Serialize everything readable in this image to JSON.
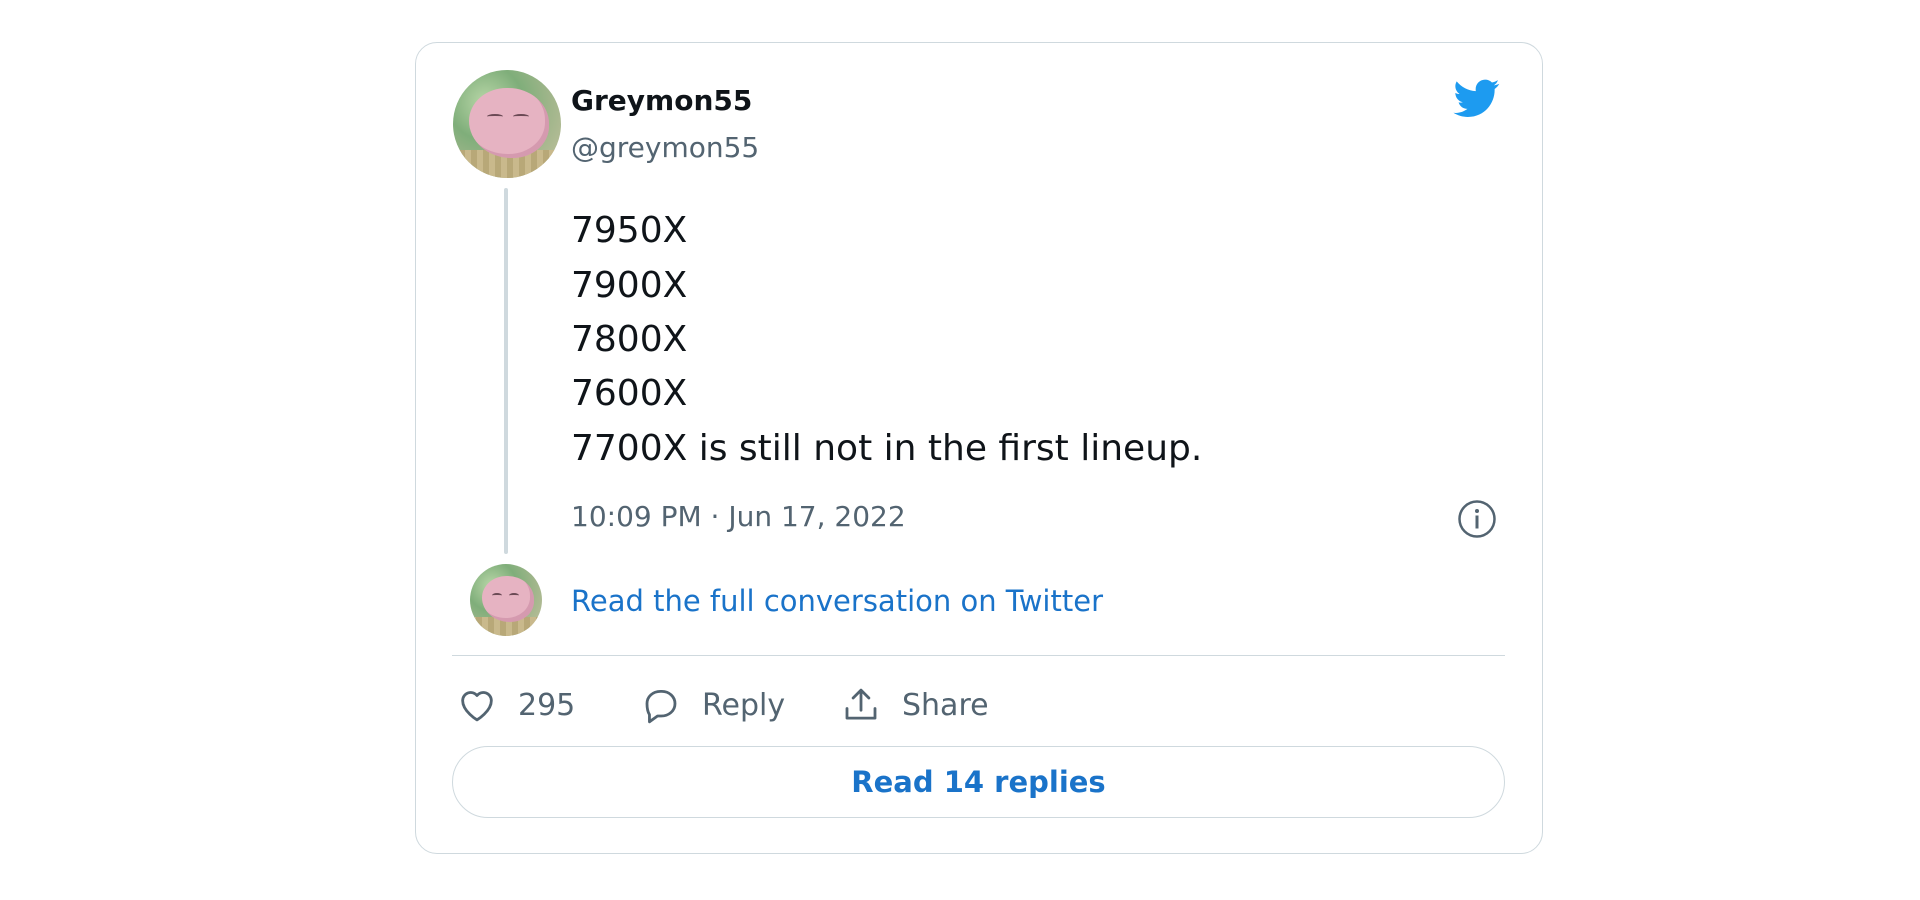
{
  "tweet": {
    "display_name": "Greymon55",
    "handle": "@greymon55",
    "lines": [
      "7950X",
      "7900X",
      "7800X",
      "7600X",
      "7700X is still not in the first lineup."
    ],
    "timestamp": "10:09 PM · Jun 17, 2022"
  },
  "thread": {
    "read_conversation_label": "Read the full conversation on Twitter"
  },
  "actions": {
    "like_count": "295",
    "reply_label": "Reply",
    "share_label": "Share"
  },
  "read_replies_label": "Read 14 replies",
  "colors": {
    "twitter_blue": "#1d9bf0",
    "link_blue": "#1a73c9",
    "muted_text": "#536471",
    "border": "#cfd9de"
  },
  "icons": [
    "twitter-bird-icon",
    "info-icon",
    "heart-icon",
    "reply-icon",
    "share-icon"
  ]
}
